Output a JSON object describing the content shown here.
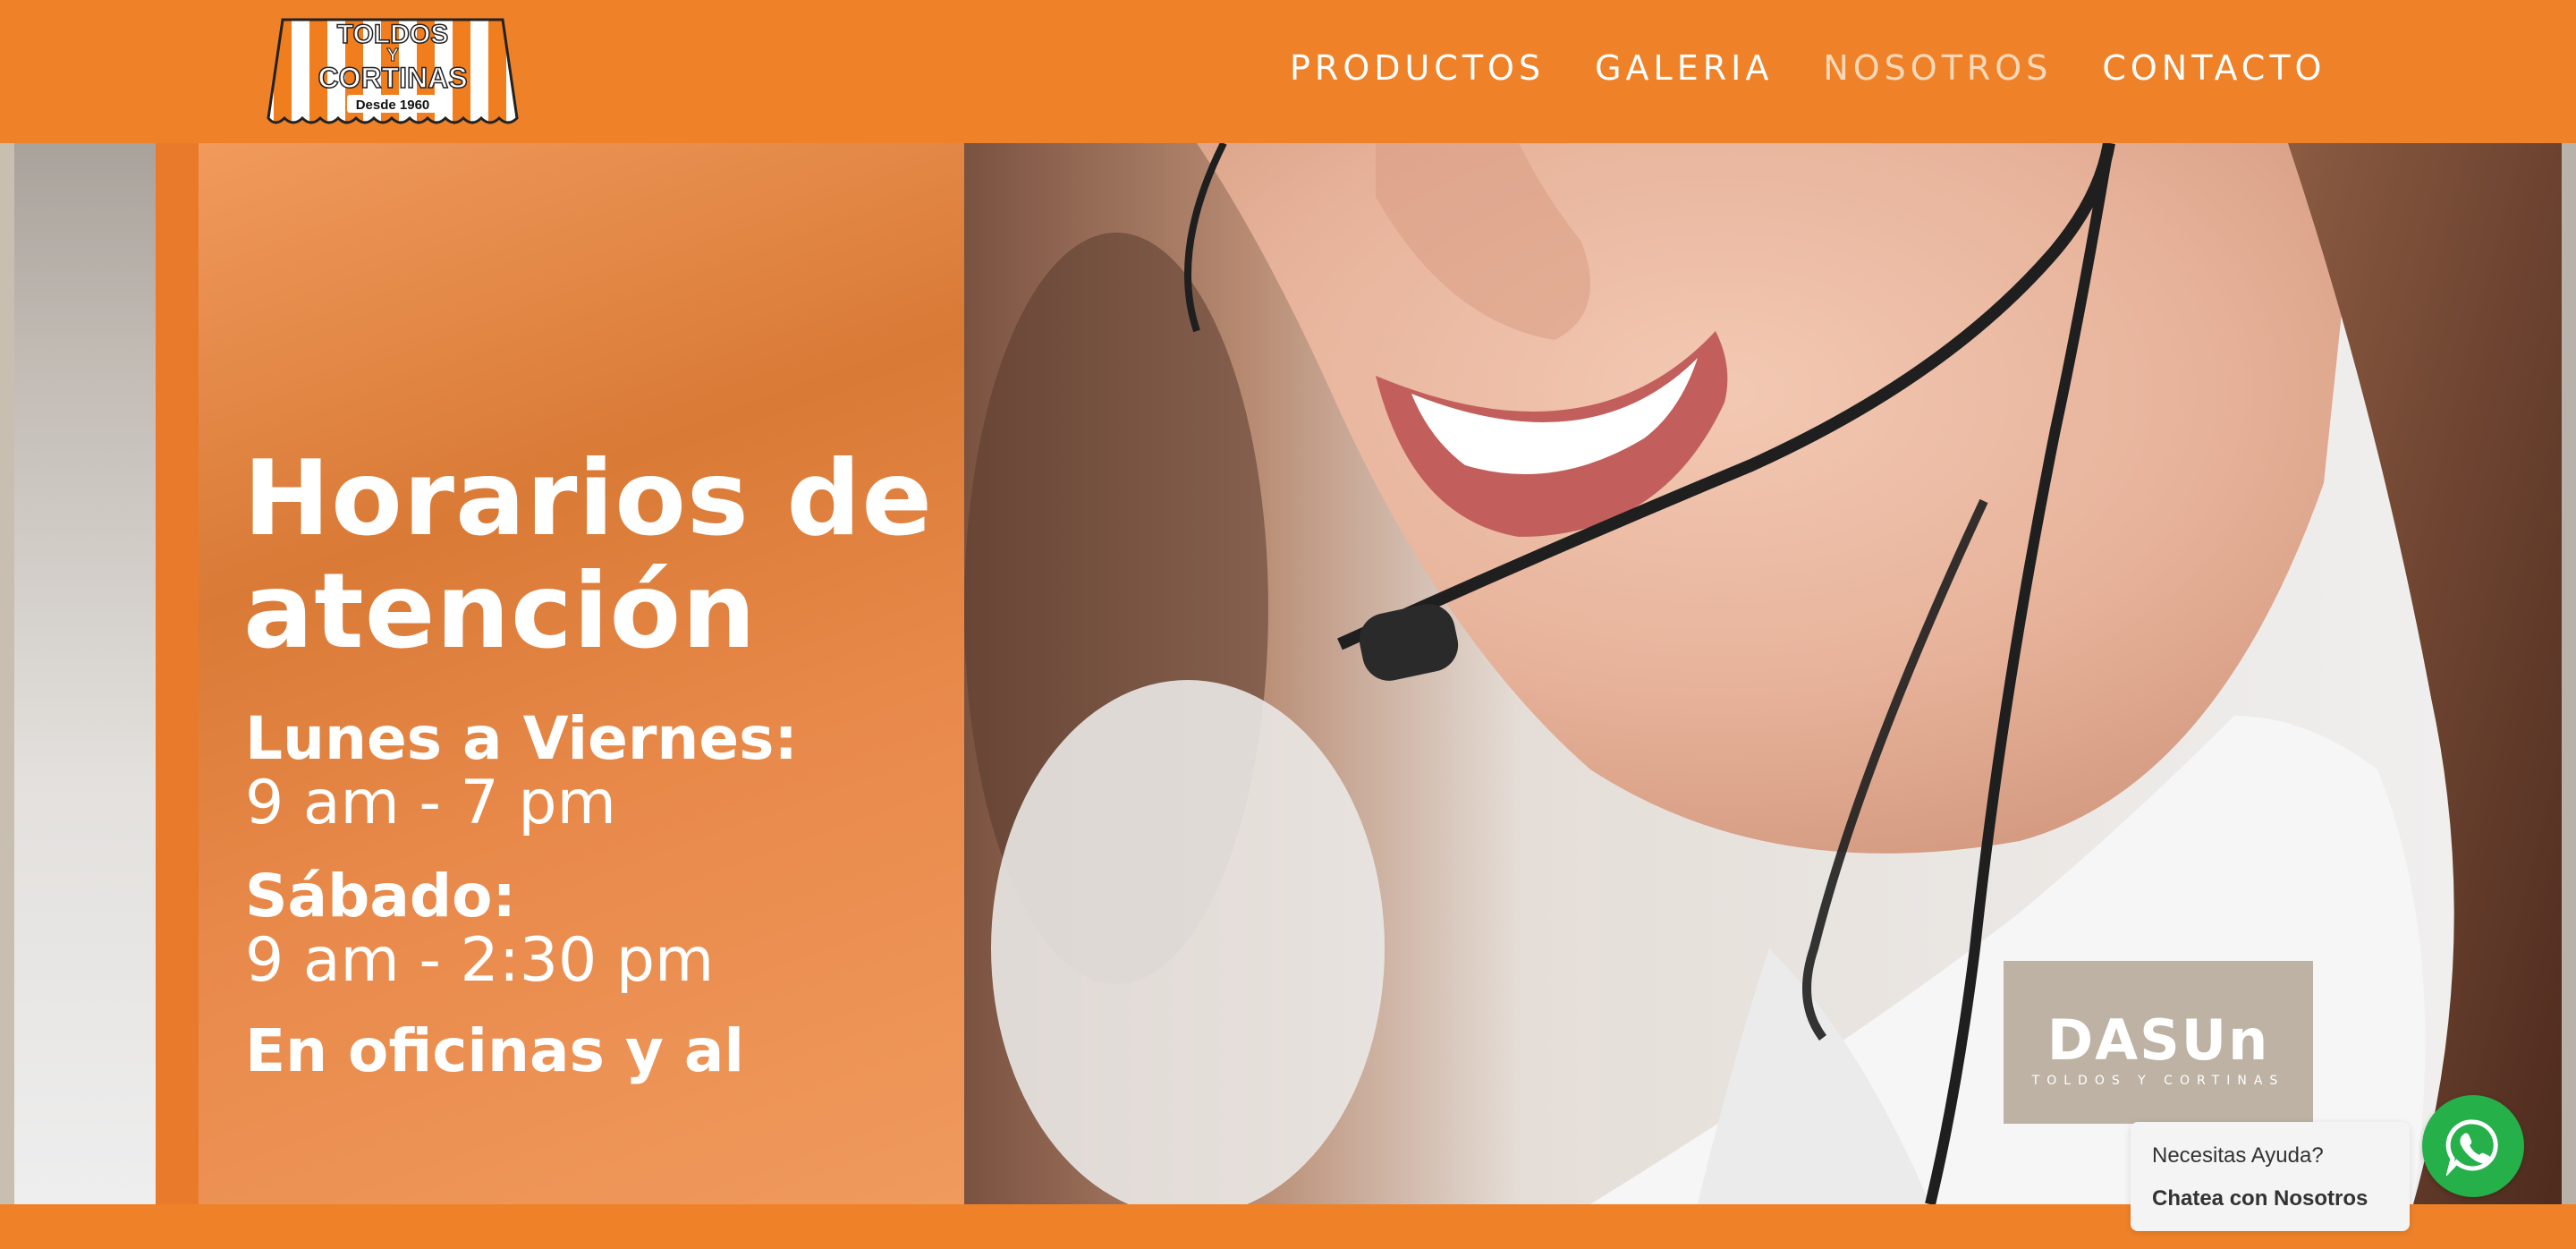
{
  "logo": {
    "line1": "TOLDOS",
    "line2": "Y",
    "line3": "CORTINAS",
    "tagline": "Desde 1960"
  },
  "nav": {
    "items": [
      {
        "label": "PRODUCTOS"
      },
      {
        "label": "GALERIA"
      },
      {
        "label": "NOSOTROS"
      },
      {
        "label": "CONTACTO"
      }
    ],
    "active": "NOSOTROS"
  },
  "hero": {
    "title_line1": "Horarios de",
    "title_line2": "atención",
    "weekdays_label": "Lunes a Viernes:",
    "weekdays_hours": "9 am - 7 pm",
    "saturday_label": "Sábado:",
    "saturday_hours": "9 am - 2:30 pm",
    "note": "En oficinas y al"
  },
  "brand_badge": {
    "name": "DASUn",
    "subtitle": "TOLDOS Y CORTINAS"
  },
  "chat": {
    "question": "Necesitas Ayuda?",
    "cta": "Chatea con Nosotros",
    "icon": "whatsapp-icon"
  },
  "colors": {
    "brand_orange": "#ef8229",
    "whatsapp_green": "#25b04a",
    "badge_beige": "#bdb2a3"
  }
}
